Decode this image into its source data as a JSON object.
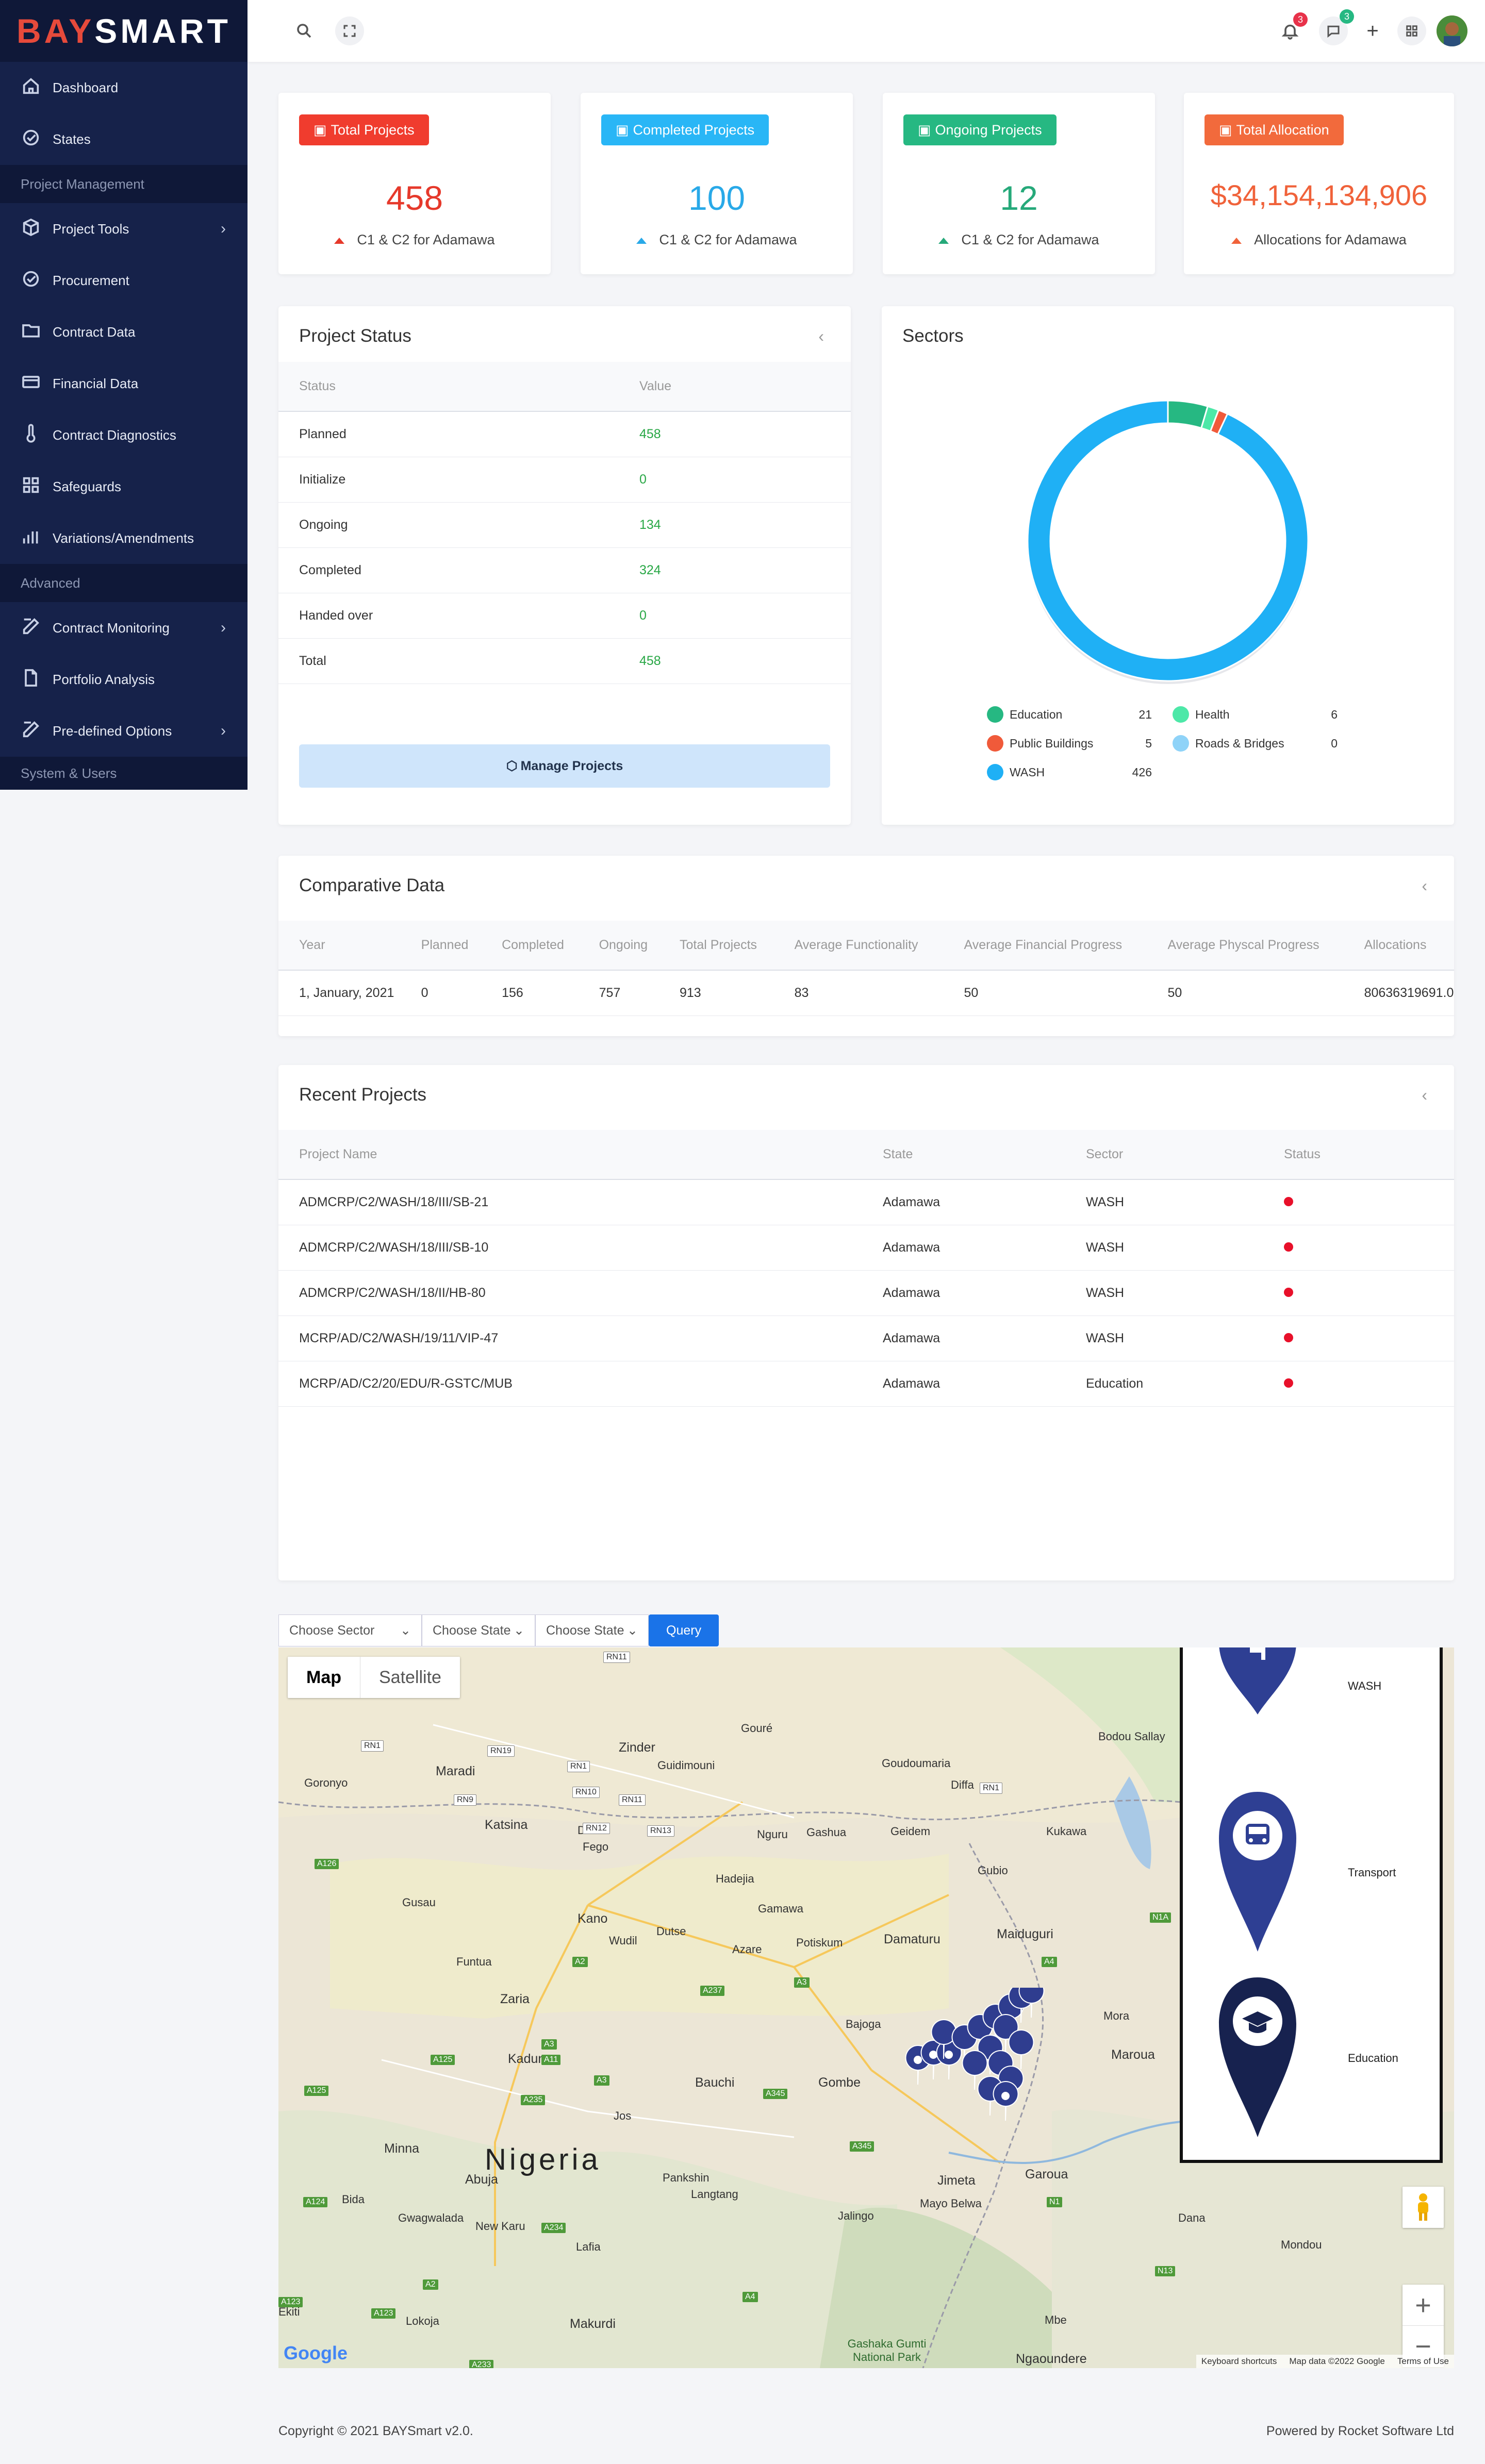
{
  "brand": {
    "part1": "BAY",
    "part2": "SMART"
  },
  "sidebar": {
    "items_top": [
      {
        "label": "Dashboard",
        "icon": "home-icon"
      },
      {
        "label": "States",
        "icon": "check-circle-icon"
      }
    ],
    "section1": "Project Management",
    "items_pm": [
      {
        "label": "Project Tools",
        "icon": "box-icon",
        "chevron": true
      },
      {
        "label": "Procurement",
        "icon": "check-circle-icon"
      },
      {
        "label": "Contract Data",
        "icon": "folder-icon"
      },
      {
        "label": "Financial Data",
        "icon": "credit-card-icon"
      },
      {
        "label": "Contract Diagnostics",
        "icon": "thermometer-icon"
      },
      {
        "label": "Safeguards",
        "icon": "grid-icon"
      },
      {
        "label": "Variations/Amendments",
        "icon": "bar-chart-icon"
      }
    ],
    "section2": "Advanced",
    "items_adv": [
      {
        "label": "Contract Monitoring",
        "icon": "edit-icon",
        "chevron": true
      },
      {
        "label": "Portfolio Analysis",
        "icon": "file-icon"
      },
      {
        "label": "Pre-defined Options",
        "icon": "edit-icon",
        "chevron": true
      }
    ],
    "section3": "System & Users"
  },
  "topbar": {
    "notifications_count": "3",
    "messages_count": "3",
    "plus": "+"
  },
  "stats": [
    {
      "label": "Total Projects",
      "value": "458",
      "sub": "C1 & C2 for Adamawa",
      "color": "#f03c2e",
      "value_color": "#e6392b"
    },
    {
      "label": "Completed Projects",
      "value": "100",
      "sub": "C1 & C2 for Adamawa",
      "color": "#29b6f6",
      "value_color": "#29a9e8"
    },
    {
      "label": "Ongoing Projects",
      "value": "12",
      "sub": "C1 & C2 for Adamawa",
      "color": "#26b882",
      "value_color": "#26a97a"
    },
    {
      "label": "Total Allocation",
      "value": "$34,154,134,906",
      "sub": "Allocations for Adamawa",
      "color": "#f26a3c",
      "value_color": "#f0623a"
    }
  ],
  "project_status": {
    "title": "Project Status",
    "headers": [
      "Status",
      "Value"
    ],
    "rows": [
      [
        "Planned",
        "458"
      ],
      [
        "Initialize",
        "0"
      ],
      [
        "Ongoing",
        "134"
      ],
      [
        "Completed",
        "324"
      ],
      [
        "Handed over",
        "0"
      ],
      [
        "Total",
        "458"
      ]
    ],
    "button": "Manage Projects"
  },
  "sectors": {
    "title": "Sectors",
    "legend": [
      {
        "name": "Education",
        "value": "21",
        "color": "#26b882"
      },
      {
        "name": "Health",
        "value": "6",
        "color": "#4de8a8"
      },
      {
        "name": "Public Buildings",
        "value": "5",
        "color": "#f05a3a"
      },
      {
        "name": "Roads & Bridges",
        "value": "0",
        "color": "#8fd3f8"
      },
      {
        "name": "WASH",
        "value": "426",
        "color": "#1fb0f5"
      }
    ]
  },
  "chart_data": {
    "type": "pie",
    "categories": [
      "Education",
      "Health",
      "Public Buildings",
      "Roads & Bridges",
      "WASH"
    ],
    "values": [
      21,
      6,
      5,
      0,
      426
    ],
    "colors": [
      "#26b882",
      "#4de8a8",
      "#f05a3a",
      "#8fd3f8",
      "#1fb0f5"
    ],
    "title": "Sectors",
    "legend": "bottom"
  },
  "comparative": {
    "title": "Comparative Data",
    "headers": [
      "Year",
      "Planned",
      "Completed",
      "Ongoing",
      "Total Projects",
      "Average Functionality",
      "Average Financial Progress",
      "Average Physcal Progress",
      "Allocations"
    ],
    "rows": [
      [
        "1, January, 2021",
        "0",
        "156",
        "757",
        "913",
        "83",
        "50",
        "50",
        "80636319691.0"
      ]
    ]
  },
  "recent": {
    "title": "Recent Projects",
    "headers": [
      "Project Name",
      "State",
      "Sector",
      "Status"
    ],
    "rows": [
      [
        "ADMCRP/C2/WASH/18/III/SB-21",
        "Adamawa",
        "WASH"
      ],
      [
        "ADMCRP/C2/WASH/18/III/SB-10",
        "Adamawa",
        "WASH"
      ],
      [
        "ADMCRP/C2/WASH/18/II/HB-80",
        "Adamawa",
        "WASH"
      ],
      [
        "MCRP/AD/C2/WASH/19/11/VIP-47",
        "Adamawa",
        "WASH"
      ],
      [
        "MCRP/AD/C2/20/EDU/R-GSTC/MUB",
        "Adamawa",
        "Education"
      ]
    ]
  },
  "filters": {
    "sector": "Choose Sector",
    "state1": "Choose State",
    "state2": "Choose State",
    "query": "Query"
  },
  "map": {
    "toggle_map": "Map",
    "toggle_satellite": "Satellite",
    "country": "Nigeria",
    "places": [
      {
        "name": "Zinder"
      },
      {
        "name": "Maradi"
      },
      {
        "name": "Katsina"
      },
      {
        "name": "Kano"
      },
      {
        "name": "Gusau"
      },
      {
        "name": "Zaria"
      },
      {
        "name": "Kaduna"
      },
      {
        "name": "Funtua"
      },
      {
        "name": "Bauchi"
      },
      {
        "name": "Gombe"
      },
      {
        "name": "Jos"
      },
      {
        "name": "Potiskum"
      },
      {
        "name": "Damaturu"
      },
      {
        "name": "Maiduguri"
      },
      {
        "name": "Azare"
      },
      {
        "name": "Hadejia"
      },
      {
        "name": "Gashua"
      },
      {
        "name": "Nguru"
      },
      {
        "name": "Geidem"
      },
      {
        "name": "Minna"
      },
      {
        "name": "Abuja"
      },
      {
        "name": "Bida"
      },
      {
        "name": "Lafia"
      },
      {
        "name": "Makurdi"
      },
      {
        "name": "Lokoja"
      },
      {
        "name": "Jimeta"
      },
      {
        "name": "Garoua"
      },
      {
        "name": "Maroua"
      },
      {
        "name": "Mora"
      },
      {
        "name": "Jalingo"
      },
      {
        "name": "Ngaoundere"
      },
      {
        "name": "Diffa"
      },
      {
        "name": "Gubio"
      },
      {
        "name": "Bajoga"
      },
      {
        "name": "Goronyo"
      },
      {
        "name": "Dutse"
      },
      {
        "name": "Wudil"
      },
      {
        "name": "Gamawa"
      },
      {
        "name": "Kukawa"
      },
      {
        "name": "Langtang"
      },
      {
        "name": "Pankshin"
      },
      {
        "name": "Mayo Belwa"
      },
      {
        "name": "Mbe"
      },
      {
        "name": "Dana"
      },
      {
        "name": "Mondou"
      },
      {
        "name": "Gouré"
      },
      {
        "name": "Bodou Sallay"
      },
      {
        "name": "Goudoumaria"
      },
      {
        "name": "Guidimouni"
      },
      {
        "name": "Daura"
      },
      {
        "name": "Fego"
      },
      {
        "name": "Gwagwalada"
      },
      {
        "name": "New Karu"
      },
      {
        "name": "Ekiti"
      }
    ],
    "park": "Gashaka Gumti National Park",
    "legend": [
      {
        "name": "WASH"
      },
      {
        "name": "Transport"
      },
      {
        "name": "Education"
      }
    ],
    "attribution": [
      "Keyboard shortcuts",
      "Map data ©2022 Google",
      "Terms of Use"
    ],
    "google": "Google"
  },
  "footer": {
    "left": "Copyright © 2021 BAYSmart v2.0.",
    "right": "Powered by Rocket Software Ltd"
  }
}
